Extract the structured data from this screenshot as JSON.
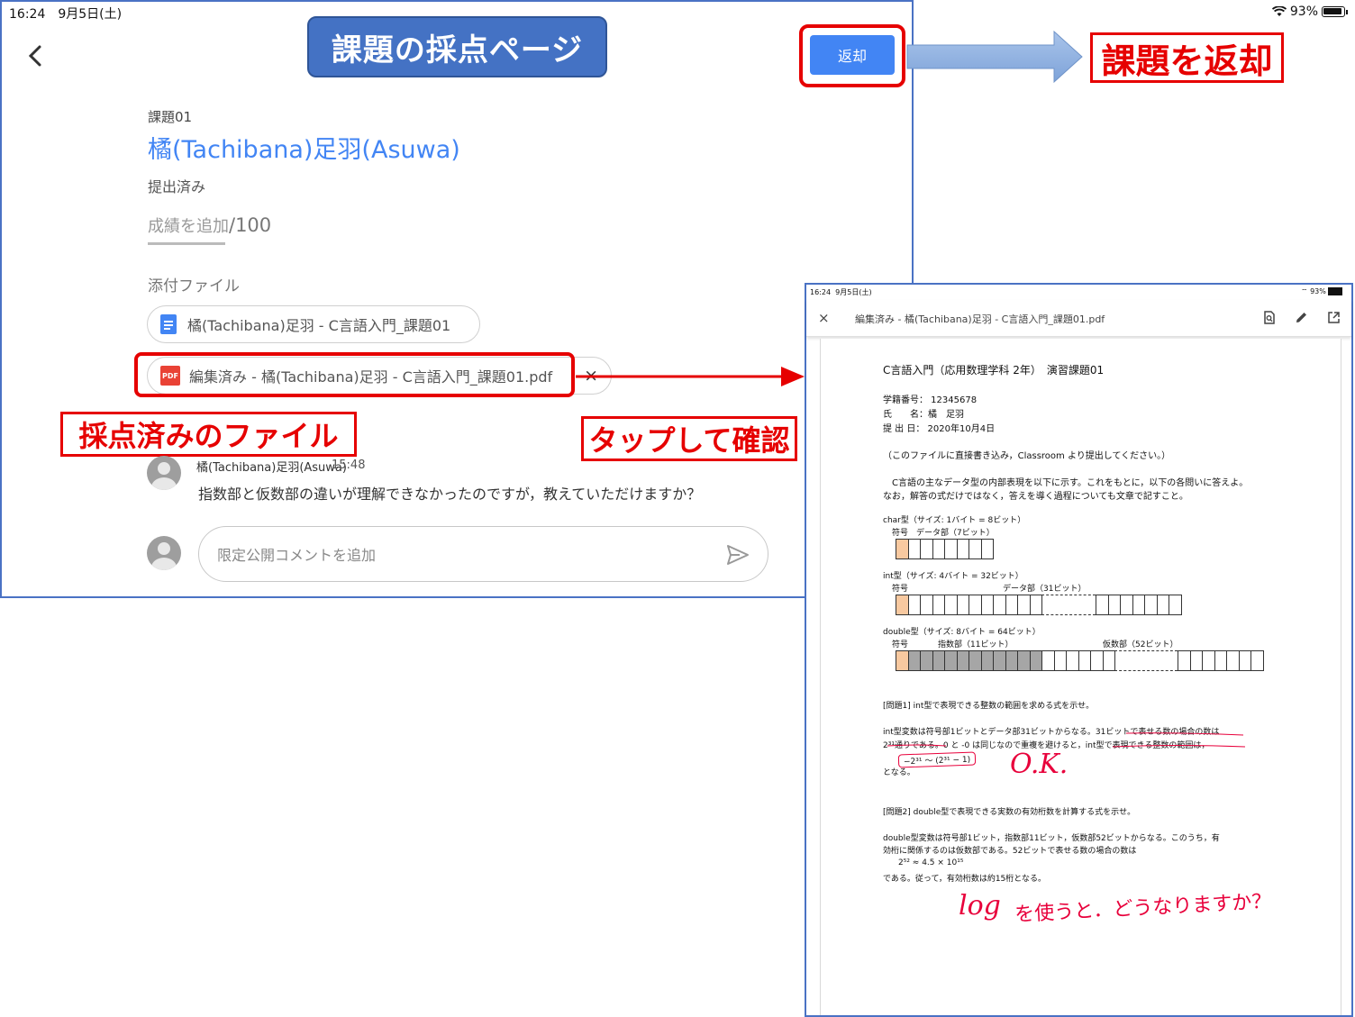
{
  "status_bar": {
    "time": "16:24",
    "date": "9月5日(土)",
    "battery": "93%"
  },
  "header": {
    "banner": "課題の採点ページ",
    "return_button": "返却"
  },
  "annotations": {
    "return_label": "課題を返却",
    "graded_file_label": "採点済みのファイル",
    "tap_label": "タップして確認"
  },
  "assignment": {
    "name": "課題01",
    "student": "橘(Tachibana)足羽(Asuwa)",
    "status": "提出済み",
    "grade_placeholder": "成績を追加",
    "grade_denominator": "/100"
  },
  "attachments": {
    "heading": "添付ファイル",
    "files": [
      {
        "name": "橘(Tachibana)足羽 - C言語入門_課題01",
        "type": "doc"
      },
      {
        "name": "編集済み - 橘(Tachibana)足羽 - C言語入門_課題01.pdf",
        "type": "pdf"
      }
    ],
    "pdf_badge": "PDF",
    "remove_icon": "×"
  },
  "comment": {
    "author": "橘(Tachibana)足羽(Asuwa)",
    "time": "15:48",
    "text": "指数部と仮数部の違いが理解できなかったのですが，教えていただけますか？",
    "input_placeholder": "限定公開コメントを追加"
  },
  "pdf_viewer": {
    "status_time": "16:24",
    "status_date": "9月5日(土)",
    "status_battery": "93%",
    "close_icon": "×",
    "title": "編集済み - 橘(Tachibana)足羽 - C言語入門_課題01.pdf",
    "doc": {
      "title": "C言語入門（応用数理学科 2年）　演習課題01",
      "id_line": "学籍番号：  12345678",
      "name_line": "氏　　名：橘　足羽",
      "date_line": "提 出 日：  2020年10月4日",
      "note": "（このファイルに直接書き込み，Classroom より提出してください。）",
      "intro1": "　C言語の主なデータ型の内部表現を以下に示す。これをもとに，以下の各問いに答えよ。",
      "intro2": "なお，解答の式だけではなく，答えを導く過程についても文章で記すこと。",
      "char_label": "char型（サイズ: 1バイト = 8ビット）",
      "char_fields": "符号　データ部（7ビット）",
      "int_label": "int型（サイズ: 4バイト = 32ビット）",
      "int_sign": "符号",
      "int_data": "データ部（31ビット）",
      "double_label": "double型（サイズ: 8バイト = 64ビット）",
      "double_sign": "符号",
      "double_exp": "指数部（11ビット）",
      "double_mant": "仮数部（52ビット）",
      "q1": "[問題1] int型で表現できる整数の範囲を求める式を示せ。",
      "a1_l1": "int型変数は符号部1ビットとデータ部31ビットからなる。31ビットで表せる数の場合の数は",
      "a1_l2": "2³¹通りである。0 と -0 は同じなので重複を避けると，int型で表現できる整数の範囲は，",
      "a1_formula": "−2³¹ 〜 (2³¹ − 1)",
      "a1_end": "となる。",
      "q2": "[問題2] double型で表現できる実数の有効桁数を計算する式を示せ。",
      "a2_l1": "double型変数は符号部1ビット，指数部11ビット，仮数部52ビットからなる。このうち，有",
      "a2_l2": "効桁に関係するのは仮数部である。52ビットで表せる数の場合の数は",
      "a2_formula": "2⁵² ≈ 4.5 × 10¹⁵",
      "a2_end": "である。従って，有効桁数は約15桁となる。"
    },
    "handwriting": {
      "ok": "O.K.",
      "log": "log",
      "question": "を使うと．どうなりますか？"
    }
  }
}
